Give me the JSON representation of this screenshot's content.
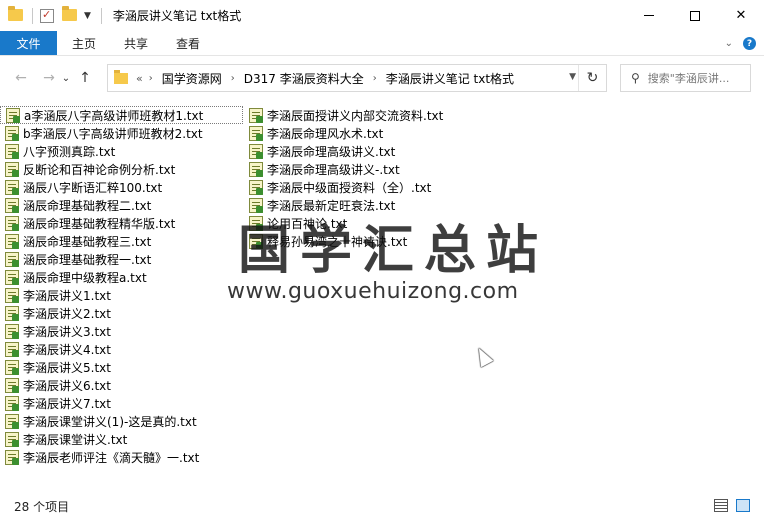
{
  "window": {
    "title": "李涵辰讲义笔记 txt格式",
    "controls": {
      "minimize": "",
      "maximize": "",
      "close": "✕"
    }
  },
  "ribbon": {
    "file_tab": "文件",
    "tabs": [
      "主页",
      "共享",
      "查看"
    ],
    "expand_icon": "⌄",
    "help_icon": "?"
  },
  "nav": {
    "back": "←",
    "forward": "→",
    "recent": "⌄",
    "up": "↑",
    "more": "«",
    "breadcrumb": [
      "国学资源网",
      "D317 李涵辰资料大全",
      "李涵辰讲义笔记 txt格式"
    ],
    "refresh": "↻",
    "search_placeholder": "搜索\"李涵辰讲..."
  },
  "files": {
    "column1": [
      "a李涵辰八字高级讲师班教材1.txt",
      "b李涵辰八字高级讲师班教材2.txt",
      "八字预测真踪.txt",
      "反断论和百神论命例分析.txt",
      "涵辰八字断语汇粹100.txt",
      "涵辰命理基础教程二.txt",
      "涵辰命理基础教程精华版.txt",
      "涵辰命理基础教程三.txt",
      "涵辰命理基础教程一.txt",
      "涵辰命理中级教程a.txt",
      "李涵辰讲义1.txt",
      "李涵辰讲义2.txt",
      "李涵辰讲义3.txt",
      "李涵辰讲义4.txt",
      "李涵辰讲义5.txt",
      "李涵辰讲义6.txt",
      "李涵辰讲义7.txt",
      "李涵辰课堂讲义(1)-这是真的.txt",
      "李涵辰课堂讲义.txt",
      "李涵辰老师评注《滴天髓》一.txt"
    ],
    "column2": [
      "李涵辰面授讲义内部交流资料.txt",
      "李涵辰命理风水术.txt",
      "李涵辰命理高级讲义.txt",
      "李涵辰命理高级讲义-.txt",
      "李涵辰中级面授资料（全）.txt",
      "李涵辰最新定旺衰法.txt",
      "论用百神论.txt",
      "释易孙易湾之十神诗诀.txt"
    ]
  },
  "watermark": {
    "title": "国学汇总站",
    "url": "www.guoxuehuizong.com"
  },
  "status": {
    "item_count": "28 个项目"
  }
}
